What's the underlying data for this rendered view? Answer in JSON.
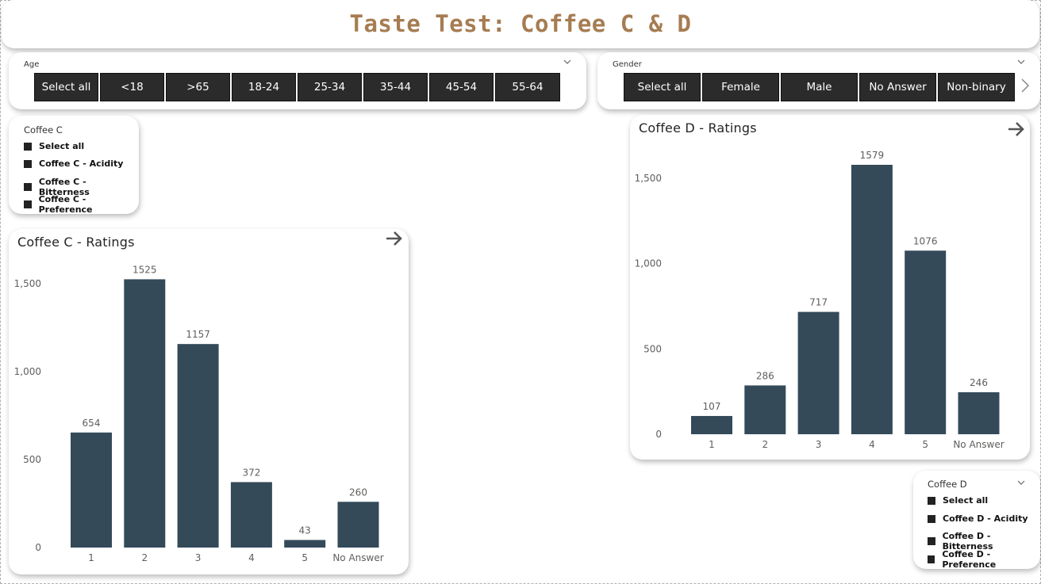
{
  "title": "Taste Test: Coffee C & D",
  "age_slicer": {
    "label": "Age",
    "options": [
      "Select all",
      "<18",
      ">65",
      "18-24",
      "25-34",
      "35-44",
      "45-54",
      "55-64"
    ]
  },
  "gender_slicer": {
    "label": "Gender",
    "options": [
      "Select all",
      "Female",
      "Male",
      "No Answer",
      "Non-binary"
    ]
  },
  "coffee_c_slicer": {
    "label": "Coffee C",
    "items": [
      "Select all",
      "Coffee C - Acidity",
      "Coffee C - Bitterness",
      "Coffee C - Preference"
    ]
  },
  "coffee_d_slicer": {
    "label": "Coffee D",
    "items": [
      "Select all",
      "Coffee D - Acidity",
      "Coffee D - Bitterness",
      "Coffee D - Preference"
    ]
  },
  "colors": {
    "bar": "#344a59",
    "title": "#a67c52",
    "tile": "#2b2b2b"
  },
  "icons": {
    "expand": "chevron-down-icon",
    "next": "chevron-right-icon",
    "drill": "arrow-right-icon"
  },
  "chart_data": [
    {
      "type": "bar",
      "title": "Coffee C - Ratings",
      "categories": [
        "1",
        "2",
        "3",
        "4",
        "5",
        "No Answer"
      ],
      "values": [
        654,
        1525,
        1157,
        372,
        43,
        260
      ],
      "yticks": [
        0,
        500,
        1000,
        1500
      ],
      "ytick_labels": [
        "0",
        "500",
        "1,000",
        "1,500"
      ],
      "ylim": [
        0,
        1600
      ],
      "grid": false
    },
    {
      "type": "bar",
      "title": "Coffee D - Ratings",
      "categories": [
        "1",
        "2",
        "3",
        "4",
        "5",
        "No Answer"
      ],
      "values": [
        107,
        286,
        717,
        1579,
        1076,
        246
      ],
      "yticks": [
        0,
        500,
        1000,
        1500
      ],
      "ytick_labels": [
        "0",
        "500",
        "1,000",
        "1,500"
      ],
      "ylim": [
        0,
        1600
      ],
      "grid": false
    }
  ]
}
